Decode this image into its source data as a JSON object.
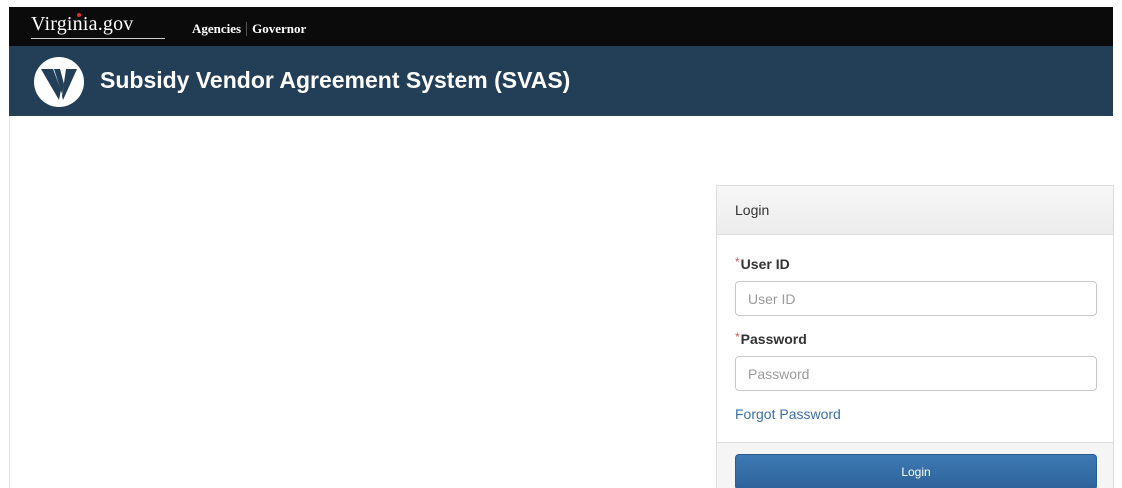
{
  "gov_bar": {
    "logo_text": "Virginia.gov",
    "links": [
      "Agencies",
      "Governor"
    ]
  },
  "app_bar": {
    "title": "Subsidy Vendor Agreement System (SVAS)"
  },
  "login_panel": {
    "heading": "Login",
    "user_id": {
      "required_marker": "*",
      "label": "User ID",
      "placeholder": "User ID",
      "value": ""
    },
    "password": {
      "required_marker": "*",
      "label": "Password",
      "placeholder": "Password",
      "value": ""
    },
    "forgot_password": "Forgot Password",
    "login_button": "Login"
  },
  "colors": {
    "gov_bar_bg": "#0b0b0b",
    "app_bar_bg": "#233f57",
    "link": "#3a6ea5",
    "button": "#2d6399",
    "required": "#d9534f"
  }
}
